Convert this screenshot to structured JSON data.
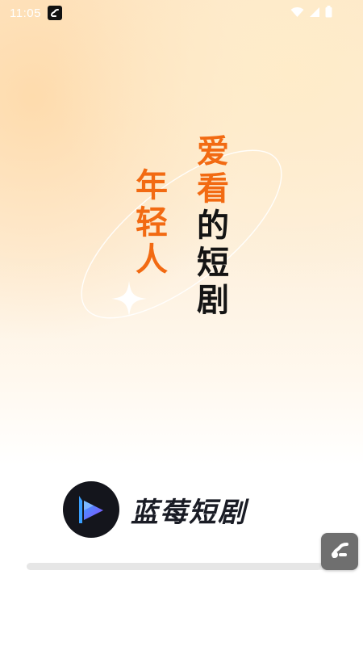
{
  "status_bar": {
    "time": "11:05",
    "icons": [
      "app-notification-icon",
      "wifi-icon",
      "signal-icon",
      "battery-icon"
    ]
  },
  "slogan": {
    "left_chars": [
      "年",
      "轻",
      "人"
    ],
    "right_chars": [
      "爱",
      "看",
      "的",
      "短",
      "剧"
    ],
    "accent_color": "#f26a12",
    "dark_color": "#141414"
  },
  "brand": {
    "app_name": "蓝莓短剧",
    "logo_icon": "play-logo-icon",
    "logo_colors": [
      "#3aa0ff",
      "#8a4dff",
      "#14151c"
    ]
  },
  "loading": {
    "progress": 0.95
  },
  "overlay_button": {
    "icon": "link-app-icon"
  }
}
